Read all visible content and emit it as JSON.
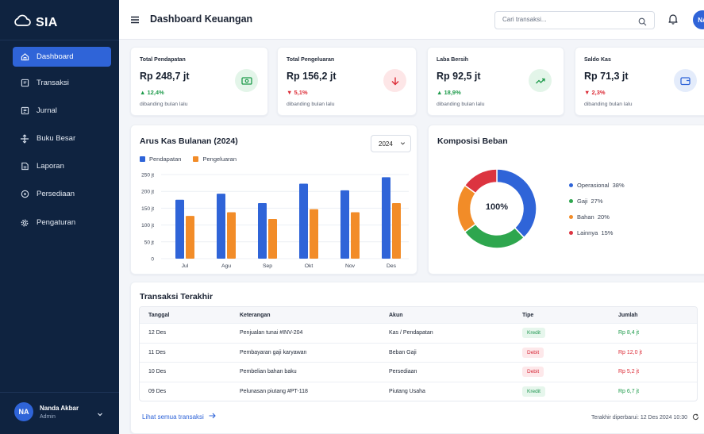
{
  "app": {
    "brand": "SIA"
  },
  "header": {
    "title": "Dashboard Keuangan",
    "search_placeholder": "Cari transaksi...",
    "avatar_initials": "NA"
  },
  "sidebar": {
    "items": [
      {
        "label": "Dashboard",
        "icon": "home-icon",
        "active": true
      },
      {
        "label": "Transaksi",
        "icon": "receipt-icon"
      },
      {
        "label": "Jurnal",
        "icon": "book-icon"
      },
      {
        "label": "Buku Besar",
        "icon": "ledger-icon"
      },
      {
        "label": "Laporan",
        "icon": "report-icon"
      },
      {
        "label": "Persediaan",
        "icon": "box-icon"
      },
      {
        "label": "Pengaturan",
        "icon": "gear-icon"
      }
    ],
    "user": {
      "initials": "NA",
      "name": "Nanda Akbar",
      "role": "Admin"
    }
  },
  "kpis": [
    {
      "label": "Total Pendapatan",
      "value": "Rp 248,7 jt",
      "change": "▲ 12,4%",
      "trend": "up",
      "note": "dibanding bulan lalu",
      "icon": "cash-icon",
      "icon_bg": "#e3f5e9",
      "icon_color": "#1e9b4b"
    },
    {
      "label": "Total Pengeluaran",
      "value": "Rp 156,2 jt",
      "change": "▼ 5,1%",
      "trend": "down",
      "note": "dibanding bulan lalu",
      "icon": "arrow-down-icon",
      "icon_bg": "#fde6e7",
      "icon_color": "#dc2d38"
    },
    {
      "label": "Laba Bersih",
      "value": "Rp 92,5 jt",
      "change": "▲ 18,9%",
      "trend": "up",
      "note": "dibanding bulan lalu",
      "icon": "trending-up-icon",
      "icon_bg": "#e3f5e9",
      "icon_color": "#1e9b4b"
    },
    {
      "label": "Saldo Kas",
      "value": "Rp 71,3 jt",
      "change": "▼ 2,3%",
      "trend": "down",
      "note": "dibanding bulan lalu",
      "icon": "wallet-icon",
      "icon_bg": "#e4ecfb",
      "icon_color": "#2f64d8"
    }
  ],
  "cashflow": {
    "title": "Arus Kas Bulanan (2024)",
    "year_selected": "2024"
  },
  "composition": {
    "title": "Komposisi Beban",
    "center_label": "100%"
  },
  "chart_data": [
    {
      "type": "bar",
      "title": "Arus Kas Bulanan (2024)",
      "categories": [
        "Jul",
        "Agu",
        "Sep",
        "Okt",
        "Nov",
        "Des"
      ],
      "series": [
        {
          "name": "Pendapatan",
          "color": "#2f64d8",
          "values": [
            175,
            193,
            165,
            223,
            203,
            242
          ]
        },
        {
          "name": "Pengeluaran",
          "color": "#f28c28",
          "values": [
            127,
            138,
            118,
            147,
            138,
            165
          ]
        }
      ],
      "yticks": [
        "0",
        "50 jt",
        "100 jt",
        "150 jt",
        "200 jt",
        "250 jt"
      ],
      "ylim": [
        0,
        250
      ],
      "legend": "top-left",
      "grid": true
    },
    {
      "type": "pie",
      "title": "Komposisi Beban",
      "slices": [
        {
          "label": "Operasional",
          "value": 38,
          "color": "#2f64d8"
        },
        {
          "label": "Gaji",
          "value": 27,
          "color": "#2ea64e"
        },
        {
          "label": "Bahan",
          "value": 20,
          "color": "#f28c28"
        },
        {
          "label": "Lainnya",
          "value": 15,
          "color": "#dc3440"
        }
      ],
      "legend": "right"
    }
  ],
  "transactions": {
    "title": "Transaksi Terakhir",
    "columns": [
      "Tanggal",
      "Keterangan",
      "Akun",
      "Tipe",
      "Jumlah"
    ],
    "rows": [
      {
        "date": "12 Des",
        "desc": "Penjualan tunai #INV-204",
        "account": "Kas / Pendapatan",
        "type": "Kredit",
        "amount": "Rp 8,4 jt"
      },
      {
        "date": "11 Des",
        "desc": "Pembayaran gaji karyawan",
        "account": "Beban Gaji",
        "type": "Debit",
        "amount": "Rp 12,0 jt"
      },
      {
        "date": "10 Des",
        "desc": "Pembelian bahan baku",
        "account": "Persediaan",
        "type": "Debit",
        "amount": "Rp 5,2 jt"
      },
      {
        "date": "09 Des",
        "desc": "Pelunasan piutang #PT-118",
        "account": "Piutang Usaha",
        "type": "Kredit",
        "amount": "Rp 6,7 jt"
      }
    ],
    "see_all": "Lihat semua transaksi",
    "updated": "Terakhir diperbarui: 12 Des 2024 10:30"
  }
}
